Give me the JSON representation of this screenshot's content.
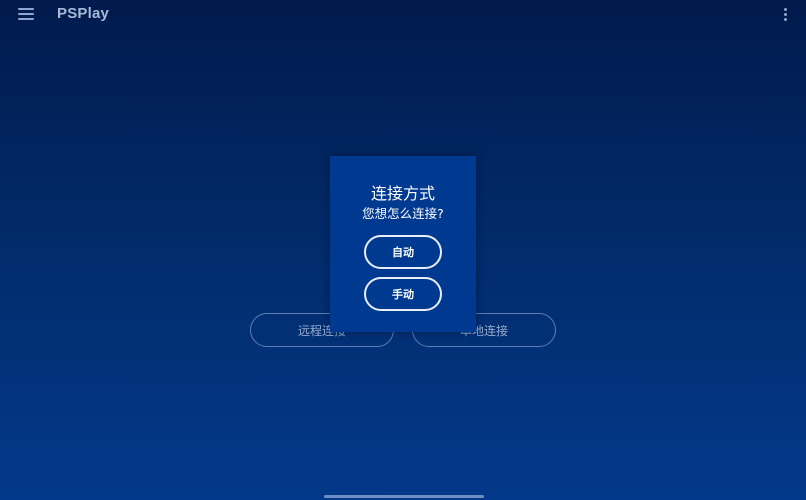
{
  "app": {
    "title": "PSPlay"
  },
  "icons": {
    "menu": "hamburger-menu-icon",
    "more": "vertical-dots-icon"
  },
  "background_buttons": {
    "remote_label": "远程连接",
    "local_label": "本地连接"
  },
  "dialog": {
    "title": "连接方式",
    "subtitle": "您想怎么连接?",
    "auto_label": "自动",
    "manual_label": "手动"
  },
  "colors": {
    "background_top": "#011a4d",
    "background_bottom": "#03398a",
    "dialog_background": "#003a90",
    "text": "#ffffff"
  }
}
